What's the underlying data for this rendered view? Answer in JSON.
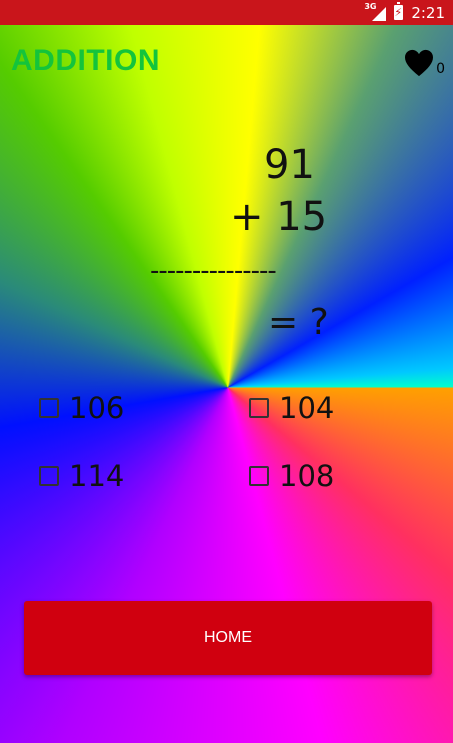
{
  "status_bar": {
    "network_label": "3G",
    "time": "2:21"
  },
  "header": {
    "title": "ADDITION",
    "lives_count": "0"
  },
  "problem": {
    "operand_1": "91",
    "operand_2": "+ 15",
    "divider": "---------------",
    "answer_prompt": "= ?"
  },
  "options": [
    {
      "label": "106"
    },
    {
      "label": "104"
    },
    {
      "label": "114"
    },
    {
      "label": "108"
    }
  ],
  "footer": {
    "home_label": "HOME"
  },
  "colors": {
    "status_bar": "#c9151b",
    "title": "#14c43c",
    "home_button": "#d0000f"
  }
}
